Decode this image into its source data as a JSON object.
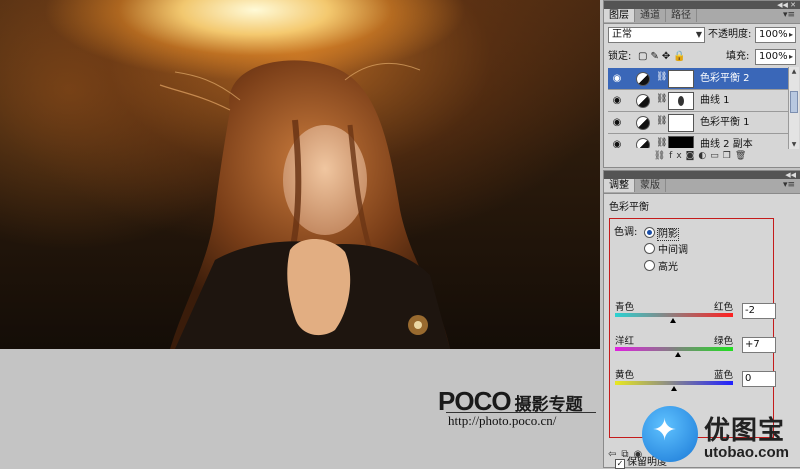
{
  "layers_panel": {
    "tabs": [
      "图层",
      "通道",
      "路径"
    ],
    "active_tab": 0,
    "blend_mode": "正常",
    "opacity_label": "不透明度:",
    "opacity_value": "100%",
    "lock_label": "锁定:",
    "fill_label": "填充:",
    "fill_value": "100%",
    "layers": [
      {
        "name": "色彩平衡 2",
        "selected": true
      },
      {
        "name": "曲线 1",
        "selected": false
      },
      {
        "name": "色彩平衡 1",
        "selected": false
      },
      {
        "name": "曲线 2 副本",
        "selected": false
      }
    ]
  },
  "adjust_panel": {
    "tabs": [
      "调整",
      "蒙版"
    ],
    "active_tab": 0,
    "title": "色彩平衡",
    "tone_label": "色调:",
    "tone_options": [
      "阴影",
      "中间调",
      "高光"
    ],
    "tone_selected": 0,
    "sliders": [
      {
        "left": "青色",
        "right": "红色",
        "value": "-2",
        "position": 0.49
      },
      {
        "left": "洋红",
        "right": "绿色",
        "value": "+7",
        "position": 0.535
      },
      {
        "left": "黄色",
        "right": "蓝色",
        "value": "0",
        "position": 0.5
      }
    ],
    "preserve_label": "保留明度",
    "preserve_checked": true
  },
  "watermark": {
    "logo": "POCO",
    "title": "摄影专题",
    "url": "http://photo.poco.cn/"
  },
  "badge": {
    "name": "优图宝",
    "url": "utobao.com"
  },
  "colors": {
    "selection": "#3a67b8",
    "highlight_box": "#c41b1b",
    "badge_blue": "#1a78d6"
  }
}
